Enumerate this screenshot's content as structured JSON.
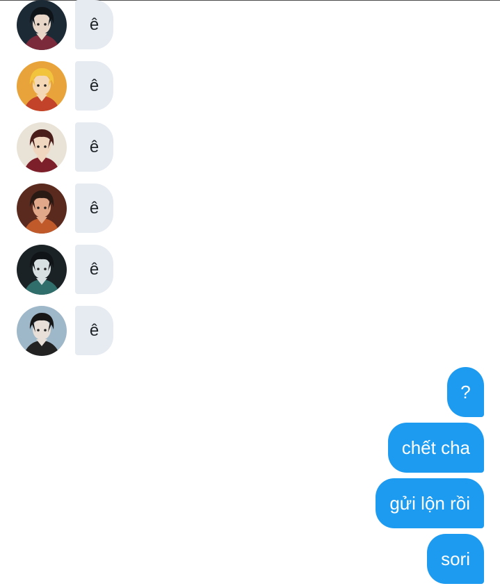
{
  "thread": {
    "incoming": [
      {
        "text": "ê",
        "avatar": {
          "icon": "user-avatar-icon",
          "bg": "#1c2a36",
          "hair": "#0f1419",
          "skin": "#e8d7c8",
          "accent": "#7a2a3a"
        }
      },
      {
        "text": "ê",
        "avatar": {
          "icon": "user-avatar-icon",
          "bg": "#e8a43a",
          "hair": "#f2c33d",
          "skin": "#f4d8b6",
          "accent": "#c2422a"
        }
      },
      {
        "text": "ê",
        "avatar": {
          "icon": "user-avatar-icon",
          "bg": "#e9e2d6",
          "hair": "#4a1e1a",
          "skin": "#f1d6bf",
          "accent": "#7c1f2a"
        }
      },
      {
        "text": "ê",
        "avatar": {
          "icon": "user-avatar-icon",
          "bg": "#5a2a1f",
          "hair": "#2a1a14",
          "skin": "#e2a88a",
          "accent": "#c05a2a"
        }
      },
      {
        "text": "ê",
        "avatar": {
          "icon": "user-avatar-icon",
          "bg": "#1b2226",
          "hair": "#101417",
          "skin": "#d9e0e2",
          "accent": "#2f6e6a"
        }
      },
      {
        "text": "ê",
        "avatar": {
          "icon": "user-avatar-icon",
          "bg": "#9fb8c9",
          "hair": "#161616",
          "skin": "#e7dfd8",
          "accent": "#222222"
        }
      }
    ],
    "outgoing": [
      {
        "text": "?"
      },
      {
        "text": "chết cha"
      },
      {
        "text": "gửi lộn rồi"
      },
      {
        "text": "sori"
      }
    ]
  },
  "colors": {
    "incoming_bubble": "#e6ebf1",
    "outgoing_bubble": "#1d9bf0"
  }
}
